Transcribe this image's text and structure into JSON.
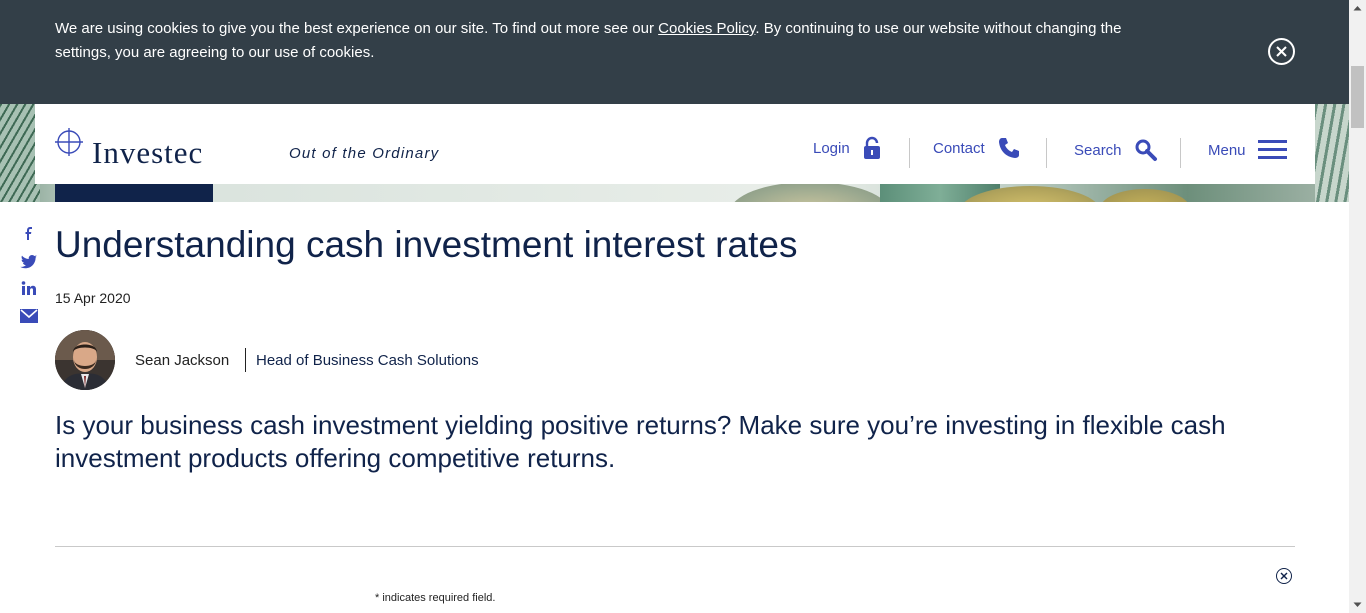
{
  "cookie_banner": {
    "text_before": "We are using cookies to give you the best experience on our site. To find out more see our ",
    "link_text": "Cookies Policy",
    "text_after": ". By continuing to use our website without changing the settings, you are agreeing to our use of cookies.",
    "close_icon": "close-circle-icon"
  },
  "header": {
    "logo_text": "Investec",
    "tagline": "Out of the Ordinary",
    "nav": {
      "login": "Login",
      "contact": "Contact",
      "search": "Search",
      "menu": "Menu"
    },
    "icons": {
      "login": "padlock-icon",
      "contact": "phone-icon",
      "search": "search-icon",
      "menu": "hamburger-menu-icon"
    },
    "accent_color": "#3a4bb8",
    "brand_color": "#10234a"
  },
  "social": [
    "facebook-icon",
    "twitter-icon",
    "linkedin-icon",
    "email-icon"
  ],
  "article": {
    "title": "Understanding cash investment interest rates",
    "date": "15 Apr 2020",
    "author_name": "Sean Jackson",
    "author_role": "Head of Business Cash Solutions",
    "lead": "Is your business cash investment yielding positive returns? Make sure you’re investing in flexible cash investment products offering competitive returns."
  },
  "form": {
    "required_note": "* indicates required field."
  }
}
